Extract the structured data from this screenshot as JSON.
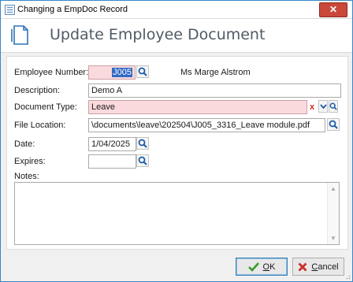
{
  "window": {
    "title": "Changing a EmpDoc Record",
    "close_label": "✕"
  },
  "header": {
    "title": "Update Employee Document"
  },
  "form": {
    "employee_number_label": "Employee Number:",
    "employee_number_value": "J005",
    "employee_name": "Ms Marge Alstrom",
    "description_label": "Description:",
    "description_value": "Demo A",
    "document_type_label": "Document Type:",
    "document_type_value": "Leave",
    "file_location_label": "File Location:",
    "file_location_value": "\\documents\\leave\\202504\\J005_3316_Leave module.pdf",
    "date_label": "Date:",
    "date_value": "1/04/2025",
    "expires_label": "Expires:",
    "expires_value": "",
    "notes_label": "Notes:",
    "notes_value": ""
  },
  "buttons": {
    "ok_label": "OK",
    "ok_mnemonic": "O",
    "ok_rest": "K",
    "cancel_label": "Cancel",
    "cancel_mnemonic": "C",
    "cancel_rest": "ancel"
  },
  "icons": {
    "search": "search-icon",
    "clear": "clear-icon",
    "dropdown": "chevron-down-icon",
    "ok": "checkmark-icon",
    "cancel": "x-icon",
    "document": "document-icon"
  },
  "colors": {
    "required_field": "#fadadd",
    "accent": "#316ac5",
    "close": "#c9483a"
  }
}
